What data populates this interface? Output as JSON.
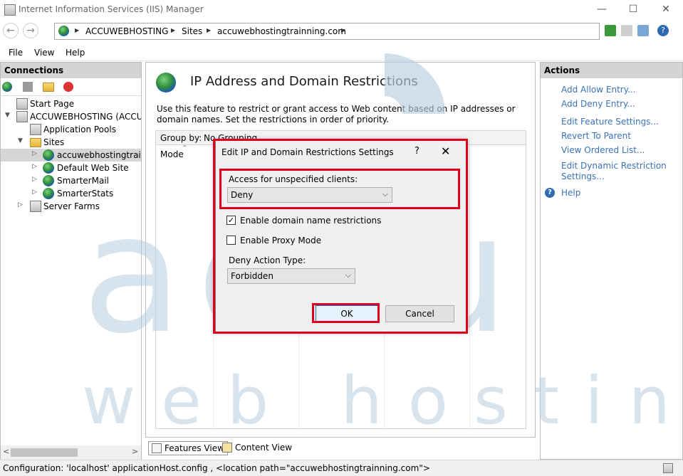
{
  "window": {
    "title": "Internet Information Services (IIS) Manager",
    "controls": {
      "minimize": "—",
      "maximize": "☐",
      "close": "✕"
    }
  },
  "address_bar": {
    "crumbs": [
      "ACCUWEBHOSTING",
      "Sites",
      "accuwebhostingtrainning.com"
    ]
  },
  "menu": [
    "File",
    "View",
    "Help"
  ],
  "connections": {
    "header": "Connections",
    "tree": [
      {
        "label": "Start Page"
      },
      {
        "label": "ACCUWEBHOSTING (ACCUW"
      },
      {
        "label": "Application Pools"
      },
      {
        "label": "Sites"
      },
      {
        "label": "accuwebhostingtrainn"
      },
      {
        "label": "Default Web Site"
      },
      {
        "label": "SmarterMail"
      },
      {
        "label": "SmarterStats"
      },
      {
        "label": "Server Farms"
      }
    ]
  },
  "main": {
    "title": "IP Address and Domain Restrictions",
    "description": "Use this feature to restrict or grant access to Web content based on IP addresses or domain names. Set the restrictions in order of priority.",
    "group_by_label": "Group by:",
    "group_by_value": "No Grouping",
    "column_mode": "Mode",
    "view_tabs": [
      "Features View",
      "Content View"
    ]
  },
  "actions": {
    "header": "Actions",
    "links": [
      "Add Allow Entry...",
      "Add Deny Entry...",
      "Edit Feature Settings...",
      "Revert To Parent",
      "View Ordered List...",
      "Edit Dynamic Restriction",
      "Settings...",
      "Help"
    ]
  },
  "dialog": {
    "title": "Edit IP and Domain Restrictions Settings",
    "help": "?",
    "close": "✕",
    "access_label": "Access for unspecified clients:",
    "access_value": "Deny",
    "enable_domain_label": "Enable domain name restrictions",
    "enable_domain_checked": true,
    "enable_proxy_label": "Enable Proxy Mode",
    "enable_proxy_checked": false,
    "deny_action_label": "Deny Action Type:",
    "deny_action_value": "Forbidden",
    "ok": "OK",
    "cancel": "Cancel"
  },
  "status": {
    "text": "Configuration: 'localhost' applicationHost.config , <location path=\"accuwebhostingtrainning.com\">"
  },
  "watermark": {
    "brand": "accu",
    "tagline": "web hosting"
  },
  "colors": {
    "highlight_red": "#e0001b",
    "link_blue": "#3a72b8",
    "watermark": "#b9cfe0"
  }
}
